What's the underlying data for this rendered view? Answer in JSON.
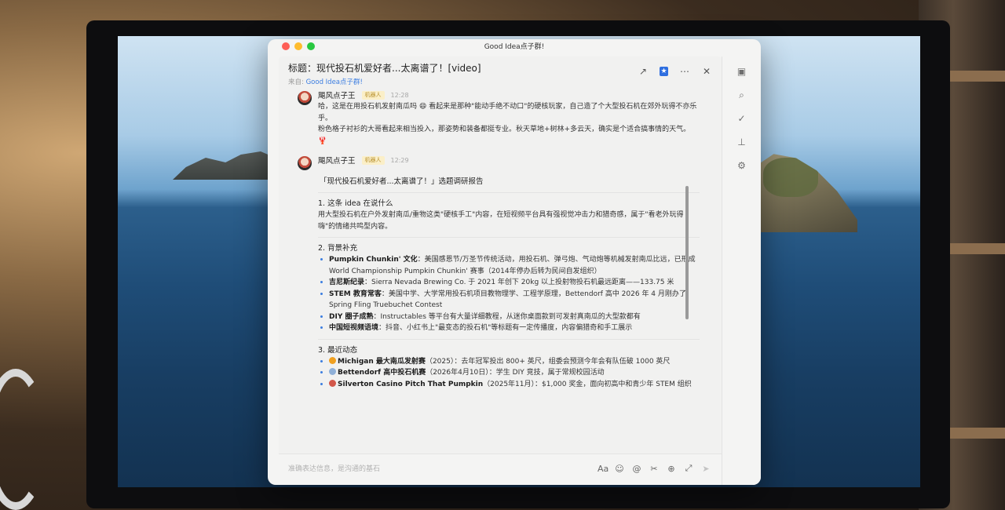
{
  "window": {
    "title": "Good Idea点子群!"
  },
  "header": {
    "title": "标题：现代投石机爱好者...太离谱了！[video]",
    "from_prefix": "来自: ",
    "from_group": "Good Idea点子群!"
  },
  "messages": [
    {
      "sender": "飓风点子王",
      "tag": "机器人",
      "time": "12:28",
      "lines": [
        "哈，这是在用投石机发射南瓜吗 😄 看起来是那种\"能动手绝不动口\"的硬核玩家，自己造了个大型投石机在郊外玩得不亦乐乎。",
        "粉色格子衬衫的大哥看起来相当投入，那姿势和装备都挺专业。秋天草地+树林+多云天，确实是个适合搞事情的天气。"
      ],
      "emoji": "🦞"
    },
    {
      "sender": "飓风点子王",
      "tag": "机器人",
      "time": "12:29"
    }
  ],
  "report": {
    "title": "「现代投石机爱好者...太离谱了！」选题调研报告",
    "sec1_title": "1. 这条 idea 在说什么",
    "sec1_body": "用大型投石机在户外发射南瓜/重物这类\"硬核手工\"内容，在短视频平台具有强视觉冲击力和猎奇感，属于\"看老外玩得嗨\"的情绪共鸣型内容。",
    "sec2_title": "2. 背景补充",
    "sec2_items": [
      {
        "b": "Pumpkin Chunkin' 文化",
        "t": "：美国感恩节/万圣节传统活动，用投石机、弹弓炮、气动炮等机械发射南瓜比远，已形成 World Championship Pumpkin Chunkin' 赛事（2014年停办后转为民间自发组织）"
      },
      {
        "b": "吉尼斯纪录",
        "t": "：Sierra Nevada Brewing Co. 于 2021 年创下 20kg 以上投射物投石机最远距离——133.75 米"
      },
      {
        "b": "STEM 教育常客",
        "t": "：美国中学、大学常用投石机项目教物理学、工程学原理，Bettendorf 高中 2026 年 4 月刚办了 Spring Fling Truebuchet Contest"
      },
      {
        "b": "DIY 圈子成熟",
        "t": "：Instructables 等平台有大量详细教程，从迷你桌面款到可发射真南瓜的大型款都有"
      },
      {
        "b": "中国短视频语境",
        "t": "：抖音、小红书上\"最变态的投石机\"等标题有一定传播度，内容偏猎奇和手工展示"
      }
    ],
    "sec3_title": "3. 最近动态",
    "sec3_items": [
      {
        "b": "Michigan 最大南瓜发射赛",
        "t": "（2025）：去年冠军投出 800+ 英尺，组委会预测今年会有队伍破 1000 英尺",
        "color": "#f0a020"
      },
      {
        "b": "Bettendorf 高中投石机赛",
        "t": "（2026年4月10日）：学生 DIY 竞技，属于常规校园活动",
        "color": "#8fb0d8"
      },
      {
        "b": "Silverton Casino Pitch That Pumpkin",
        "t": "（2025年11月）：$1,000 奖金，面向初高中和青少年 STEM 组织",
        "color": "#d2574a"
      }
    ]
  },
  "input": {
    "placeholder": "准确表达信息，是沟通的基石"
  },
  "icons": {
    "share": "share-icon",
    "bookmark": "bookmark-icon",
    "more": "more-icon",
    "close": "close-icon"
  }
}
